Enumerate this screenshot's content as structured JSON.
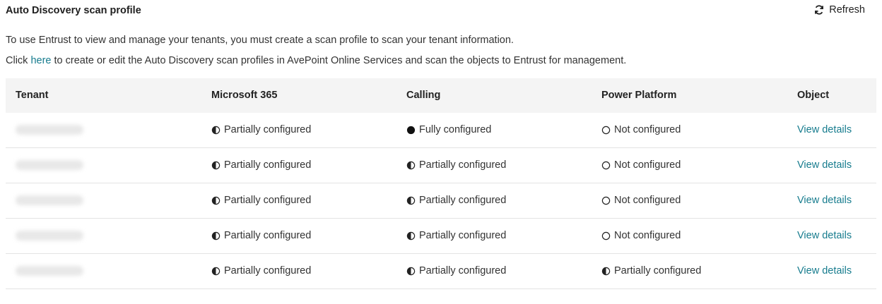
{
  "header": {
    "title": "Auto Discovery scan profile",
    "refresh_label": "Refresh"
  },
  "description": {
    "line1": "To use Entrust to view and manage your tenants, you must create a scan profile to scan your tenant information.",
    "line2_prefix": "Click ",
    "line2_link": "here",
    "line2_suffix": " to create or edit the Auto Discovery scan profiles in AvePoint Online Services and scan the objects to Entrust for management."
  },
  "table": {
    "columns": [
      "Tenant",
      "Microsoft 365",
      "Calling",
      "Power Platform",
      "Object"
    ],
    "rows": [
      {
        "ms365": "Partially configured",
        "ms365_icon": "half-circle-icon",
        "calling": "Fully configured",
        "calling_icon": "filled-circle-icon",
        "power": "Not configured",
        "power_icon": "empty-circle-icon",
        "object": "View details"
      },
      {
        "ms365": "Partially configured",
        "ms365_icon": "half-circle-icon",
        "calling": "Partially configured",
        "calling_icon": "half-circle-icon",
        "power": "Not configured",
        "power_icon": "empty-circle-icon",
        "object": "View details"
      },
      {
        "ms365": "Partially configured",
        "ms365_icon": "half-circle-icon",
        "calling": "Partially configured",
        "calling_icon": "half-circle-icon",
        "power": "Not configured",
        "power_icon": "empty-circle-icon",
        "object": "View details"
      },
      {
        "ms365": "Partially configured",
        "ms365_icon": "half-circle-icon",
        "calling": "Partially configured",
        "calling_icon": "half-circle-icon",
        "power": "Not configured",
        "power_icon": "empty-circle-icon",
        "object": "View details"
      },
      {
        "ms365": "Partially configured",
        "ms365_icon": "half-circle-icon",
        "calling": "Partially configured",
        "calling_icon": "half-circle-icon",
        "power": "Partially configured",
        "power_icon": "half-circle-icon",
        "object": "View details"
      }
    ]
  },
  "colors": {
    "link": "#177c8e",
    "header_bg": "#f4f4f4",
    "row_divider": "#e3e3e3"
  }
}
